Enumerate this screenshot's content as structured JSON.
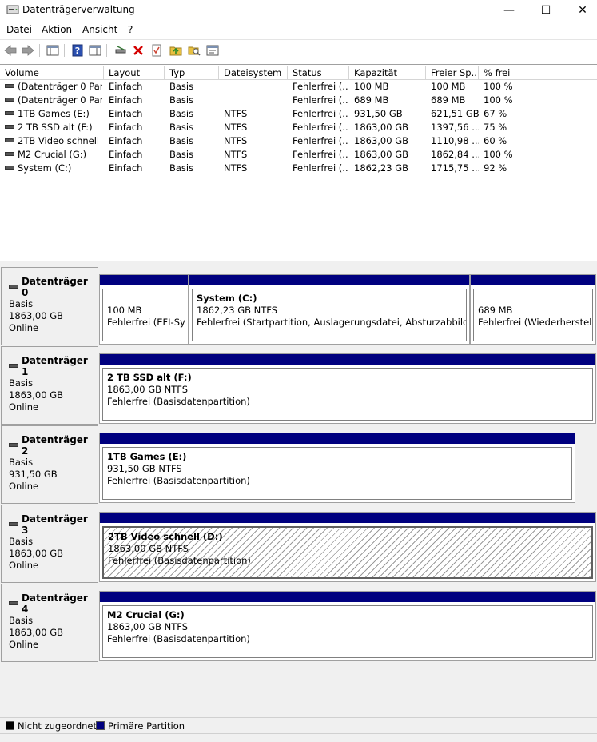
{
  "window": {
    "title": "Datenträgerverwaltung",
    "minimize": "—",
    "maximize": "☐",
    "close": "✕"
  },
  "menu": [
    "Datei",
    "Aktion",
    "Ansicht",
    "?"
  ],
  "columns": [
    "Volume",
    "Layout",
    "Typ",
    "Dateisystem",
    "Status",
    "Kapazität",
    "Freier Sp...",
    "% frei"
  ],
  "volumes": [
    [
      "(Datenträger 0 Par...",
      "Einfach",
      "Basis",
      "",
      "Fehlerfrei (...",
      "100 MB",
      "100 MB",
      "100 %"
    ],
    [
      "(Datenträger 0 Par...",
      "Einfach",
      "Basis",
      "",
      "Fehlerfrei (...",
      "689 MB",
      "689 MB",
      "100 %"
    ],
    [
      "1TB Games (E:)",
      "Einfach",
      "Basis",
      "NTFS",
      "Fehlerfrei (...",
      "931,50 GB",
      "621,51 GB",
      "67 %"
    ],
    [
      "2 TB SSD alt (F:)",
      "Einfach",
      "Basis",
      "NTFS",
      "Fehlerfrei (...",
      "1863,00 GB",
      "1397,56 ...",
      "75 %"
    ],
    [
      "2TB Video schnell ...",
      "Einfach",
      "Basis",
      "NTFS",
      "Fehlerfrei (...",
      "1863,00 GB",
      "1110,98 ...",
      "60 %"
    ],
    [
      "M2 Crucial (G:)",
      "Einfach",
      "Basis",
      "NTFS",
      "Fehlerfrei (...",
      "1863,00 GB",
      "1862,84 ...",
      "100 %"
    ],
    [
      "System (C:)",
      "Einfach",
      "Basis",
      "NTFS",
      "Fehlerfrei (...",
      "1862,23 GB",
      "1715,75 ...",
      "92 %"
    ]
  ],
  "disks": [
    {
      "name": "Datenträger 0",
      "type": "Basis",
      "size": "1863,00 GB",
      "state": "Online",
      "partitions": [
        {
          "title": "",
          "line1": "100 MB",
          "line2": "Fehlerfrei (EFI-Syst"
        },
        {
          "title": "System  (C:)",
          "line1": "1862,23 GB NTFS",
          "line2": "Fehlerfrei (Startpartition, Auslagerungsdatei, Absturzabbild, Basi"
        },
        {
          "title": "",
          "line1": "689 MB",
          "line2": "Fehlerfrei (Wiederherstellur"
        }
      ]
    },
    {
      "name": "Datenträger 1",
      "type": "Basis",
      "size": "1863,00 GB",
      "state": "Online",
      "partitions": [
        {
          "title": "2 TB SSD alt  (F:)",
          "line1": "1863,00 GB NTFS",
          "line2": "Fehlerfrei (Basisdatenpartition)"
        }
      ]
    },
    {
      "name": "Datenträger 2",
      "type": "Basis",
      "size": "931,50 GB",
      "state": "Online",
      "partitions": [
        {
          "title": "1TB Games  (E:)",
          "line1": "931,50 GB NTFS",
          "line2": "Fehlerfrei (Basisdatenpartition)"
        }
      ]
    },
    {
      "name": "Datenträger 3",
      "type": "Basis",
      "size": "1863,00 GB",
      "state": "Online",
      "partitions": [
        {
          "title": "2TB Video schnell  (D:)",
          "line1": "1863,00 GB NTFS",
          "line2": "Fehlerfrei (Basisdatenpartition)"
        }
      ]
    },
    {
      "name": "Datenträger 4",
      "type": "Basis",
      "size": "1863,00 GB",
      "state": "Online",
      "partitions": [
        {
          "title": "M2 Crucial  (G:)",
          "line1": "1863,00 GB NTFS",
          "line2": "Fehlerfrei (Basisdatenpartition)"
        }
      ]
    }
  ],
  "legend": {
    "unallocated": "Nicht zugeordnet",
    "primary": "Primäre Partition",
    "unallocated_color": "#000000",
    "primary_color": "#00007f"
  },
  "colors": {
    "partition_bar": "#00007f",
    "delete_icon": "#d40000"
  },
  "toolbar_icons": [
    "back-icon",
    "forward-icon",
    "show-hide-console-tree-icon",
    "help-icon",
    "show-hide-action-pane-icon",
    "connect-disk-icon",
    "delete-icon",
    "properties-icon",
    "import-icon",
    "search-icon",
    "settings-icon"
  ]
}
